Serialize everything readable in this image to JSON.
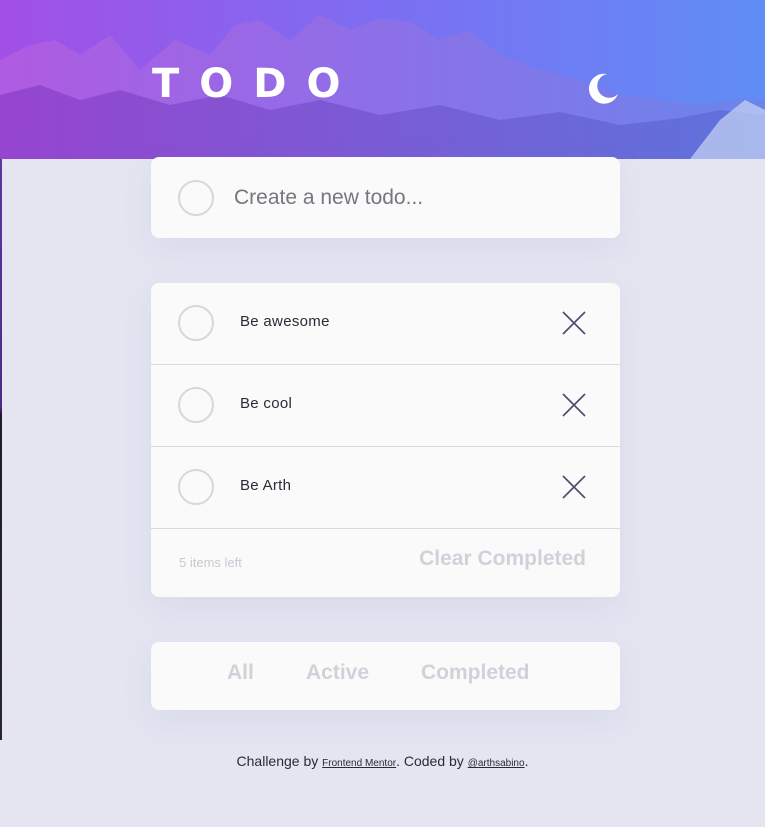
{
  "app": {
    "title": "TODO"
  },
  "icons": {
    "theme_toggle": "moon-icon",
    "todo_check": "circle-checkbox-icon",
    "delete": "cross-icon"
  },
  "new_todo": {
    "placeholder": "Create a new todo...",
    "value": ""
  },
  "todos": [
    {
      "text": "Be awesome",
      "completed": false
    },
    {
      "text": "Be cool",
      "completed": false
    },
    {
      "text": "Be Arth",
      "completed": false
    }
  ],
  "list_footer": {
    "items_left": "5 items left",
    "clear_label": "Clear Completed"
  },
  "filters": [
    {
      "label": "All"
    },
    {
      "label": "Active"
    },
    {
      "label": "Completed"
    }
  ],
  "attribution": {
    "prefix": "Challenge by ",
    "link1": "Frontend Mentor",
    "middle": ". Coded by ",
    "link2": "@arthsabino",
    "suffix": "."
  },
  "colors": {
    "page_bg": "#e4e5f1",
    "card_bg": "#fafafa",
    "gradient_start": "#a24fe6",
    "gradient_end": "#5f8ef5",
    "muted_text": "#d2d1da",
    "dark_text": "#2b2b36"
  }
}
